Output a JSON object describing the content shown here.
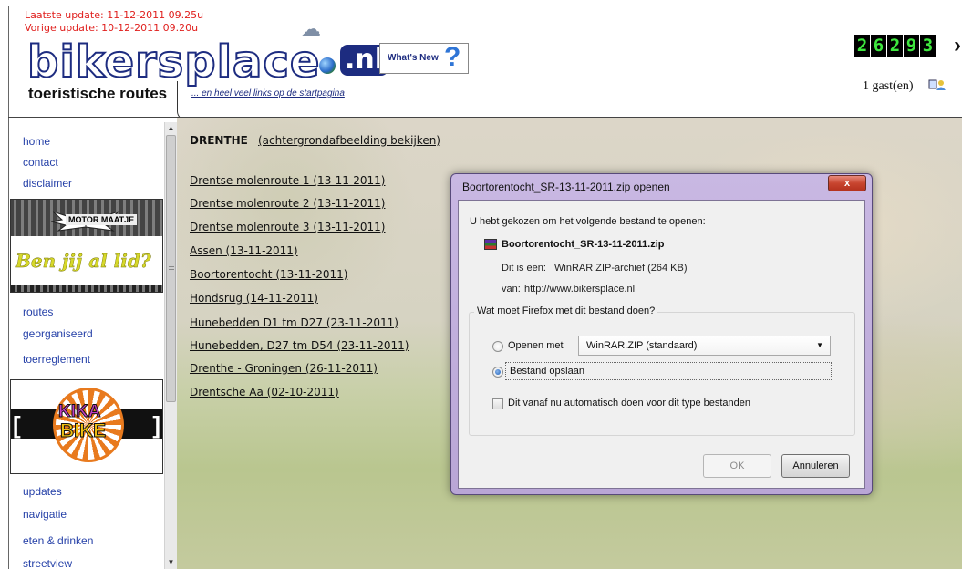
{
  "header": {
    "last_update": "Laatste update: 11-12-2011 09.25u",
    "previous_update": "Vorige update: 10-12-2011 09.20u",
    "logo_text": "bikersplace",
    "logo_tld": ".nl",
    "subtitle": "toeristische routes",
    "links_text": "... en heel veel links op de startpagina",
    "whats_new": "What's New",
    "counter_digits": [
      "2",
      "6",
      "2",
      "9",
      "3"
    ],
    "guests": "1 gast(en)"
  },
  "sidebar": {
    "links_top": [
      "home",
      "contact",
      "disclaimer"
    ],
    "banner1_text": "Ben jij al lid?",
    "banner1_badge": "MOTOR MAATJE",
    "links_middle": [
      "routes",
      "georganiseerd",
      "toerreglement"
    ],
    "banner2_text_a": "KIKA",
    "banner2_text_b": "BIKE",
    "links_bottom": [
      "updates",
      "navigatie",
      "eten & drinken",
      "streetview"
    ]
  },
  "content": {
    "region": "DRENTHE",
    "background_link": "(achtergrondafbeelding bekijken)",
    "routes": [
      "Drentse molenroute 1 (13-11-2011)",
      "Drentse molenroute 2 (13-11-2011)",
      "Drentse molenroute 3 (13-11-2011)",
      "Assen (13-11-2011)",
      "Boortorentocht (13-11-2011)",
      "Hondsrug (14-11-2011)",
      "Hunebedden D1 tm D27 (23-11-2011)",
      "Hunebedden, D27 tm D54 (23-11-2011)",
      "Drenthe - Groningen (26-11-2011)",
      "Drentsche Aa (02-10-2011)"
    ]
  },
  "dialog": {
    "title": "Boortorentocht_SR-13-11-2011.zip openen",
    "close_label": "x",
    "intro": "U hebt gekozen om het volgende bestand te openen:",
    "file_name": "Boortorentocht_SR-13-11-2011.zip",
    "type_label": "Dit is een:",
    "type_value": "WinRAR ZIP-archief (264  KB)",
    "from_label": "van:",
    "from_value": "http://www.bikersplace.nl",
    "question": "Wat moet Firefox met dit bestand doen?",
    "open_with_label": "Openen met",
    "open_with_app": "WinRAR.ZIP (standaard)",
    "save_label": "Bestand opslaan",
    "auto_label": "Dit vanaf nu automatisch doen voor dit type bestanden",
    "ok_label": "OK",
    "cancel_label": "Annuleren",
    "selected_option": "save",
    "auto_checked": false
  }
}
